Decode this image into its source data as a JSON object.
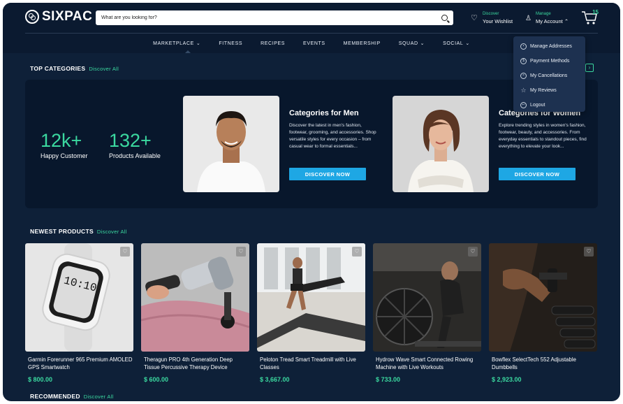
{
  "header": {
    "logo_text": "SIXPAC",
    "search_placeholder": "What are you looking for?",
    "wishlist_small": "Discover",
    "wishlist_big": "Your Wishlist",
    "account_small": "Manage",
    "account_big": "My Account ⌃",
    "cart_count": "15"
  },
  "nav": {
    "items": [
      "MARKETPLACE",
      "FITNESS",
      "RECIPES",
      "EVENTS",
      "MEMBERSHIP",
      "SQUAD",
      "SOCIAL"
    ]
  },
  "account_menu": {
    "items": [
      {
        "label": "Manage Addresses",
        "icon": "location-icon"
      },
      {
        "label": "Payment Methods",
        "icon": "dollar-icon"
      },
      {
        "label": "My Cancellations",
        "icon": "cancel-icon"
      },
      {
        "label": "My Reviews",
        "icon": "star-icon"
      },
      {
        "label": "Logout",
        "icon": "logout-icon"
      }
    ]
  },
  "top_categories": {
    "title": "TOP CATEGORIES",
    "discover": "Discover All",
    "stats": [
      {
        "value": "12k+",
        "label": "Happy Customer"
      },
      {
        "value": "132+",
        "label": "Products Available"
      }
    ],
    "cards": [
      {
        "title": "Categories for Men",
        "description": "Discover the latest in men's fashion, footwear, grooming, and accessories. Shop versatile styles for every occasion – from casual wear to formal essentials...",
        "button": "DISCOVER NOW"
      },
      {
        "title": "Categories for Women",
        "description": "Explore trending styles in women's fashion, footwear, beauty, and accessories. From everyday essentials to standout pieces, find everything to elevate your look...",
        "button": "DISCOVER NOW"
      }
    ]
  },
  "newest_products": {
    "title": "NEWEST PRODUCTS",
    "discover": "Discover All",
    "items": [
      {
        "name": "Garmin Forerunner 965 Premium AMOLED GPS Smartwatch",
        "price": "$ 800.00"
      },
      {
        "name": "Theragun PRO 4th Generation Deep Tissue Percussive Therapy Device",
        "price": "$ 600.00"
      },
      {
        "name": "Peloton Tread Smart Treadmill with Live Classes",
        "price": "$ 3,667.00"
      },
      {
        "name": "Hydrow Wave Smart Connected Rowing Machine with Live Workouts",
        "price": "$ 733.00"
      },
      {
        "name": "Bowflex SelectTech 552 Adjustable Dumbbells",
        "price": "$ 2,923.00"
      }
    ]
  },
  "recommended": {
    "title": "RECOMMENDED",
    "discover": "Discover All"
  },
  "colors": {
    "background": "#0e2038",
    "accent": "#3bd9a0",
    "button": "#1ea7e4"
  }
}
